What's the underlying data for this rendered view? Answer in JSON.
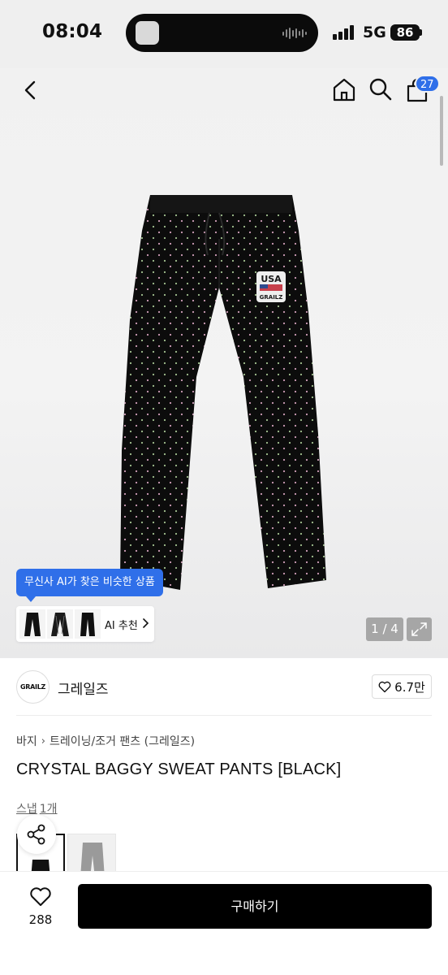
{
  "status_bar": {
    "time": "08:04",
    "network": "5G",
    "battery": "86"
  },
  "top_nav": {
    "icons": [
      "back-icon",
      "home-icon",
      "search-icon",
      "cart-icon"
    ],
    "cart_badge": "27"
  },
  "gallery": {
    "page_indicator": "1 / 4",
    "ai_tooltip": "무신사 AI가 찾은 비슷한 상품",
    "ai_recommend_label": "AI 추천",
    "product_print": {
      "line1": "USA",
      "line2": "GRAILZ"
    }
  },
  "brand": {
    "logo_text": "GRAILZ",
    "name": "그레일즈",
    "likes": "6.7만"
  },
  "breadcrumb": [
    "바지",
    "트레이닝/조거 팬츠 (그레일즈)"
  ],
  "product": {
    "title": "CRYSTAL BAGGY SWEAT PANTS [BLACK]"
  },
  "snap": {
    "label": "스냅",
    "count": "1개"
  },
  "bottom_bar": {
    "like_count": "288",
    "buy_label": "구매하기"
  },
  "colors": {
    "accent_blue": "#2f6fe9",
    "buy_button": "#000000",
    "page_indicator_bg": "#a6a6a6"
  }
}
